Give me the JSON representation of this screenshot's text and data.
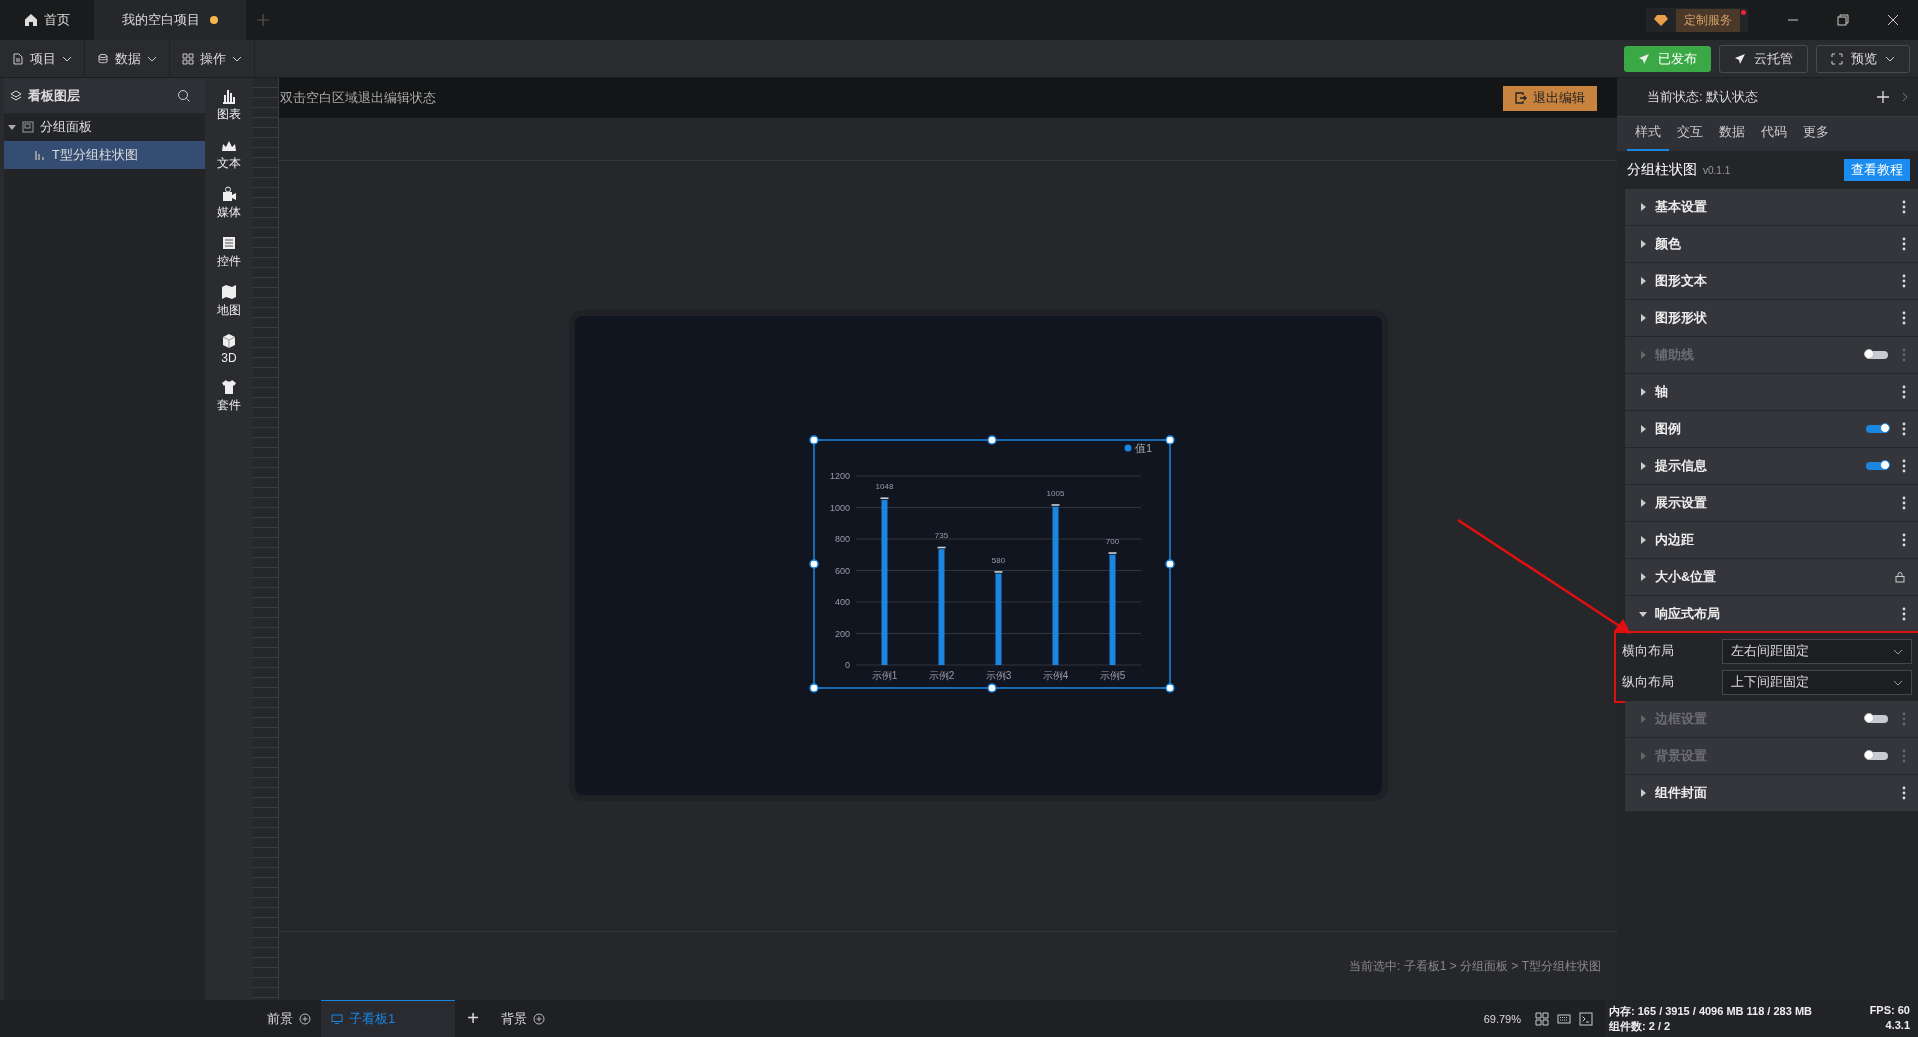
{
  "title_tabs": [
    {
      "label": "首页",
      "kind": "home",
      "selected": false,
      "modified": false
    },
    {
      "label": "我的空白项目",
      "kind": "project",
      "selected": true,
      "modified": true
    }
  ],
  "custom_service": {
    "label": "定制服务",
    "notification": true
  },
  "menu": [
    {
      "label": "项目"
    },
    {
      "label": "数据"
    },
    {
      "label": "操作"
    }
  ],
  "actions": [
    {
      "label": "已发布",
      "kind": "primary"
    },
    {
      "label": "云托管",
      "kind": "outline"
    },
    {
      "label": "预览",
      "kind": "dropdown"
    }
  ],
  "layers": {
    "title": "看板图层",
    "tree": [
      {
        "label": "分组面板",
        "expanded": true,
        "selected": false,
        "children": [
          {
            "label": "T型分组柱状图",
            "selected": true
          }
        ]
      }
    ]
  },
  "component_bar": [
    {
      "label": "图表"
    },
    {
      "label": "文本"
    },
    {
      "label": "媒体"
    },
    {
      "label": "控件"
    },
    {
      "label": "地图"
    },
    {
      "label": "3D"
    },
    {
      "label": "套件"
    }
  ],
  "canvas": {
    "hint": "双击空白区域退出编辑状态",
    "exit_button": "退出编辑",
    "breadcrumb": "当前选中: 子看板1 > 分组面板 > T型分组柱状图",
    "chart_data": {
      "type": "bar",
      "categories": [
        "示例1",
        "示例2",
        "示例3",
        "示例4",
        "示例5"
      ],
      "series": [
        {
          "name": "值1",
          "color": "#1a86e0",
          "values": [
            1048,
            735,
            580,
            1005,
            700
          ]
        }
      ],
      "ylim": [
        0,
        1200
      ],
      "yticks": [
        0,
        200,
        400,
        600,
        800,
        1000,
        1200
      ],
      "data_labels": true,
      "grid": true
    }
  },
  "inspector": {
    "state_label": "当前状态:",
    "state_value": "默认状态",
    "tabs": [
      {
        "label": "样式",
        "selected": true
      },
      {
        "label": "交互",
        "selected": false
      },
      {
        "label": "数据",
        "selected": false
      },
      {
        "label": "代码",
        "selected": false
      },
      {
        "label": "更多",
        "selected": false
      }
    ],
    "component_title": "分组柱状图",
    "version": "v0.1.1",
    "tutorial_button": "查看教程",
    "sections": [
      {
        "label": "基本设置",
        "expanded": false,
        "disabled": false,
        "locked": false
      },
      {
        "label": "颜色",
        "expanded": false,
        "disabled": false,
        "locked": false
      },
      {
        "label": "图形文本",
        "expanded": false,
        "disabled": false,
        "locked": false
      },
      {
        "label": "图形形状",
        "expanded": false,
        "disabled": false,
        "locked": false
      },
      {
        "label": "辅助线",
        "expanded": false,
        "disabled": true,
        "locked": false,
        "toggle": false
      },
      {
        "label": "轴",
        "expanded": false,
        "disabled": false,
        "locked": false
      },
      {
        "label": "图例",
        "expanded": false,
        "disabled": false,
        "locked": false,
        "toggle": true
      },
      {
        "label": "提示信息",
        "expanded": false,
        "disabled": false,
        "locked": false,
        "toggle": true
      },
      {
        "label": "展示设置",
        "expanded": false,
        "disabled": false,
        "locked": false
      },
      {
        "label": "内边距",
        "expanded": false,
        "disabled": false,
        "locked": false
      },
      {
        "label": "大小&位置",
        "expanded": false,
        "disabled": false,
        "locked": true
      },
      {
        "label": "响应式布局",
        "expanded": true,
        "disabled": false,
        "locked": false,
        "highlighted": true,
        "fields": [
          {
            "label": "横向布局",
            "value": "左右间距固定"
          },
          {
            "label": "纵向布局",
            "value": "上下间距固定"
          }
        ]
      },
      {
        "label": "边框设置",
        "expanded": false,
        "disabled": true,
        "locked": false,
        "toggle": false
      },
      {
        "label": "背景设置",
        "expanded": false,
        "disabled": true,
        "locked": false,
        "toggle": false
      },
      {
        "label": "组件封面",
        "expanded": false,
        "disabled": false,
        "locked": false
      }
    ]
  },
  "bottom": {
    "tabs": [
      {
        "label": "前景",
        "kind": "add",
        "selected": false
      },
      {
        "label": "子看板1",
        "kind": "board",
        "selected": true
      }
    ],
    "add_button": "+",
    "back_tab": {
      "label": "背景",
      "kind": "add",
      "selected": false
    },
    "zoom": "69.79%",
    "memory": "内存: 165 / 3915 / 4096 MB  118 / 283 MB",
    "fps": "FPS: 60",
    "components": "组件数: 2 / 2",
    "version": "4.3.1"
  },
  "annotation": {
    "arrow": true
  }
}
